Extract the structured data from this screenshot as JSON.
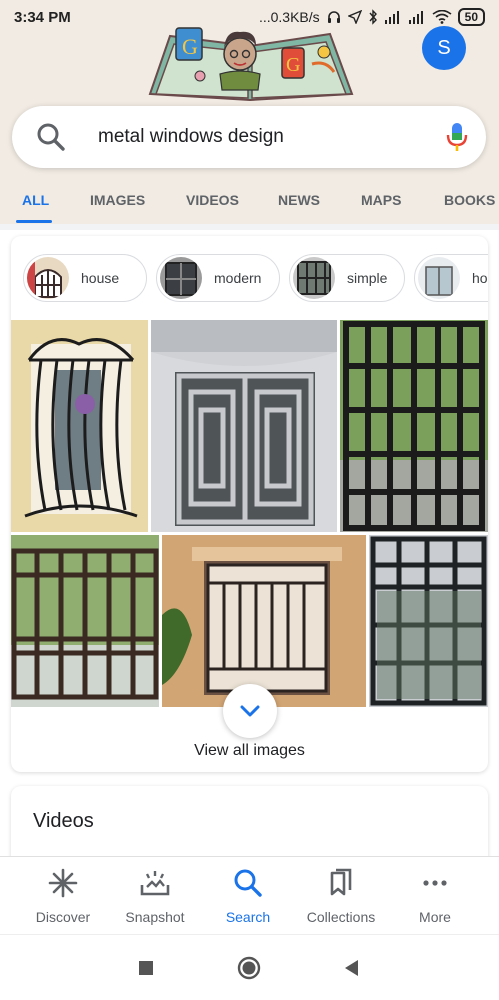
{
  "status": {
    "time": "3:34 PM",
    "network": "...0.3KB/s",
    "battery": "50"
  },
  "account": {
    "initial": "S"
  },
  "search": {
    "query": "metal windows design",
    "search_icon": "search-icon",
    "mic_icon": "mic-icon"
  },
  "tabs": [
    {
      "label": "ALL",
      "active": true
    },
    {
      "label": "IMAGES"
    },
    {
      "label": "VIDEOS"
    },
    {
      "label": "NEWS"
    },
    {
      "label": "MAPS"
    },
    {
      "label": "BOOKS"
    }
  ],
  "image_card": {
    "chips": [
      {
        "label": "house"
      },
      {
        "label": "modern"
      },
      {
        "label": "simple"
      },
      {
        "label": "hom"
      }
    ],
    "view_all": "View all images",
    "expand_icon": "chevron-down-icon"
  },
  "videos": {
    "title": "Videos"
  },
  "bottom_nav": [
    {
      "label": "Discover",
      "icon": "asterisk-icon"
    },
    {
      "label": "Snapshot",
      "icon": "snapshot-icon"
    },
    {
      "label": "Search",
      "icon": "search-icon",
      "active": true
    },
    {
      "label": "Collections",
      "icon": "bookmarks-icon"
    },
    {
      "label": "More",
      "icon": "more-dots-icon"
    }
  ],
  "colors": {
    "accent": "#1a73e8",
    "header_bg": "#f1ebe3"
  }
}
